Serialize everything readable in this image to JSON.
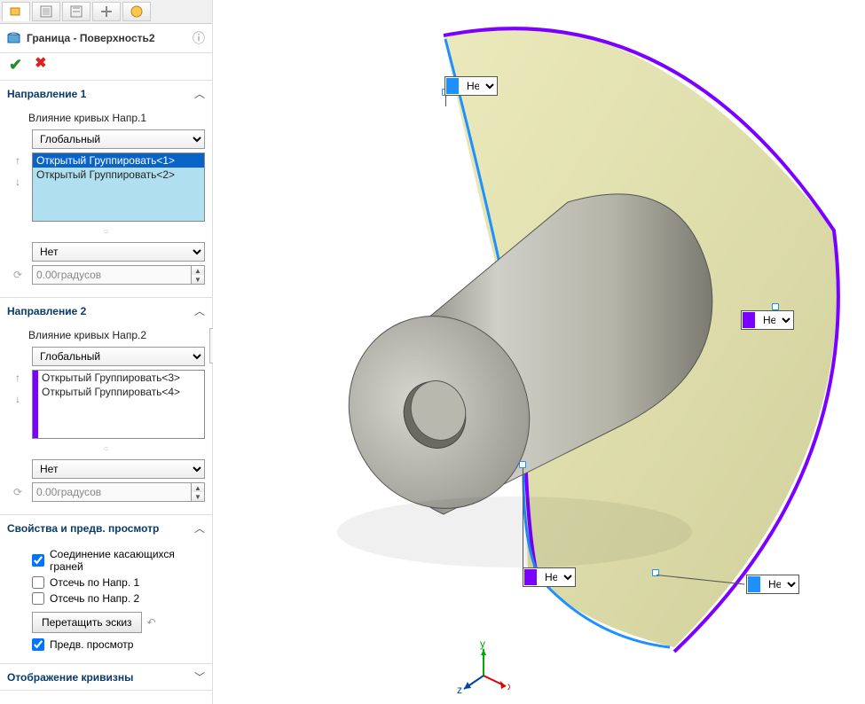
{
  "feature_title": "Граница - Поверхность2",
  "dir1": {
    "title": "Направление 1",
    "subtitle": "Влияние кривых Напр.1",
    "mode": "Глобальный",
    "items": [
      "Открытый Группировать<1>",
      "Открытый Группировать<2>"
    ],
    "tangency": "Нет",
    "angle": "0.00градусов"
  },
  "dir2": {
    "title": "Направление 2",
    "subtitle": "Влияние кривых Напр.2",
    "mode": "Глобальный",
    "items": [
      "Открытый Группировать<3>",
      "Открытый Группировать<4>"
    ],
    "tangency": "Нет",
    "angle": "0.00градусов"
  },
  "options": {
    "title": "Свойства и предв. просмотр",
    "merge": "Соединение касающихся граней",
    "trim1": "Отсечь по Напр. 1",
    "trim2": "Отсечь по Напр. 2",
    "drag": "Перетащить эскиз",
    "preview": "Предв. просмотр"
  },
  "curv": {
    "title": "Отображение кривизны"
  },
  "callout_label": "Нет",
  "triad": {
    "x": "x",
    "y": "y",
    "z": "z"
  }
}
